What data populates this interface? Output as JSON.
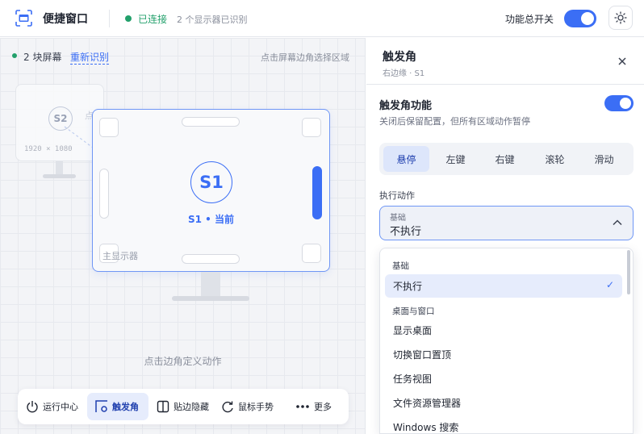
{
  "header": {
    "app_title": "便捷窗口",
    "status": "已连接",
    "monitor_count": "2 个显示器已识别",
    "master_switch_label": "功能总开关",
    "master_switch_on": true
  },
  "canvas": {
    "screens_count": "2 块屏幕",
    "redetect": "重新识别",
    "hint_top": "点击屏幕边角选择区域",
    "secondary": {
      "badge": "S2",
      "resolution": "1920 × 1080",
      "faint_label": "点"
    },
    "primary": {
      "badge": "S1",
      "label": "S1 • 当前",
      "sub_label": "主显示器",
      "active_edge": "right"
    },
    "hint_bottom": "点击边角定义动作"
  },
  "dock": {
    "items": [
      {
        "label": "运行中心",
        "icon": "power-icon"
      },
      {
        "label": "触发角",
        "icon": "corner-icon",
        "active": true
      },
      {
        "label": "贴边隐藏",
        "icon": "split-panel-icon"
      },
      {
        "label": "鼠标手势",
        "icon": "gesture-icon"
      },
      {
        "label": "更多",
        "icon": "more-dots-icon"
      }
    ]
  },
  "panel": {
    "title": "触发角",
    "subtitle": "右边缘 · S1",
    "feature": {
      "title": "触发角功能",
      "desc": "关闭后保留配置，但所有区域动作暂停",
      "enabled": true
    },
    "tabs": [
      "悬停",
      "左键",
      "右键",
      "滚轮",
      "滑动"
    ],
    "active_tab": "悬停",
    "action_label": "执行动作",
    "select": {
      "group": "基础",
      "value": "不执行"
    },
    "dropdown": {
      "group_basic": "基础",
      "item_none": "不执行",
      "group_desktop": "桌面与窗口",
      "items": [
        "显示桌面",
        "切换窗口置顶",
        "任务视图",
        "文件资源管理器",
        "Windows 搜索"
      ],
      "check": "✓"
    }
  },
  "colors": {
    "accent": "#3b6ef5",
    "success": "#22a06b"
  }
}
